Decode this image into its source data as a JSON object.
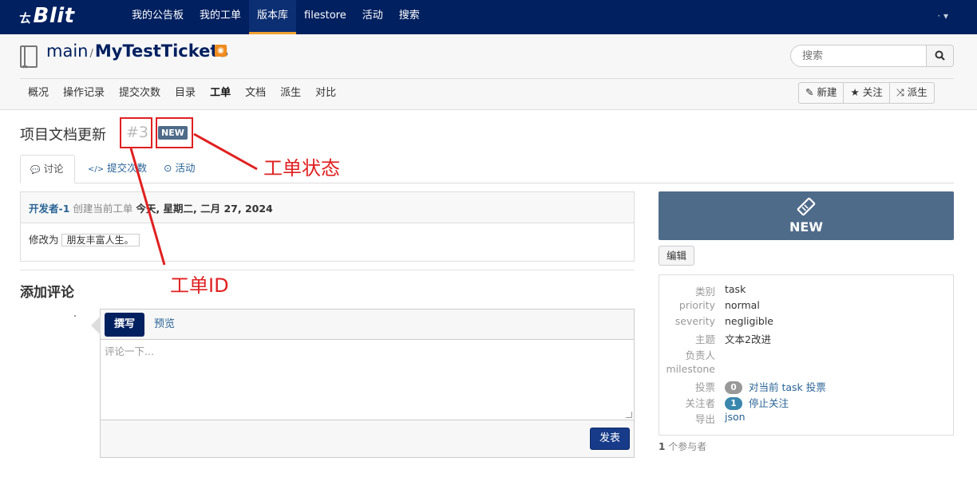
{
  "nav": {
    "logo_prefix": "ㄊ",
    "logo": "Blit",
    "items": [
      "我的公告板",
      "我的工单",
      "版本库",
      "filestore",
      "活动",
      "搜索"
    ],
    "active_index": 2,
    "user_menu": "· ▾"
  },
  "repo": {
    "project": "main",
    "separator": "/",
    "name": "MyTestTickets",
    "search_placeholder": "搜索",
    "tabs": [
      "概况",
      "操作记录",
      "提交次数",
      "目录",
      "工单",
      "文档",
      "派生",
      "对比"
    ],
    "active_tab_index": 4,
    "actions": [
      {
        "icon": "✎",
        "label": "新建"
      },
      {
        "icon": "★",
        "label": "关注"
      },
      {
        "icon": "⤨",
        "label": "派生"
      }
    ]
  },
  "ticket": {
    "title": "项目文档更新",
    "id": "#3",
    "status": "NEW",
    "tabs": [
      {
        "icon": "💬",
        "label": "讨论"
      },
      {
        "icon": "</>",
        "label": "提交次数"
      },
      {
        "icon": "⊙",
        "label": "活动"
      }
    ],
    "entry": {
      "author": "开发者-1",
      "action": "创建当前工单",
      "date": "今天, 星期二, 二月 27, 2024",
      "change_label": "修改为",
      "change_value": "朋友丰富人生。"
    },
    "add_comment_heading": "添加评论",
    "comment_tabs": [
      "撰写",
      "预览"
    ],
    "comment_placeholder": "评论一下...",
    "post_button": "发表",
    "edit_button": "编辑",
    "properties": {
      "type_label": "类别",
      "type": "task",
      "priority_label": "priority",
      "priority": "normal",
      "severity_label": "severity",
      "severity": "negligible",
      "topic_label": "主题",
      "topic": "文本2改进",
      "responsible_label": "负责人",
      "responsible": "",
      "milestone_label": "milestone",
      "milestone": "",
      "votes_label": "投票",
      "votes_count": "0",
      "votes_link": "对当前 task 投票",
      "watchers_label": "关注者",
      "watchers_count": "1",
      "watchers_link": "停止关注",
      "export_label": "导出",
      "export_link": "json"
    },
    "participants_count": "1",
    "participants_label": "个参与者"
  },
  "annotations": {
    "status_label": "工单状态",
    "id_label": "工单ID"
  },
  "colors": {
    "nav_bg": "#002060",
    "accent": "#f0a030",
    "status_bg": "#4f6b8a",
    "annotation": "#e02020"
  }
}
